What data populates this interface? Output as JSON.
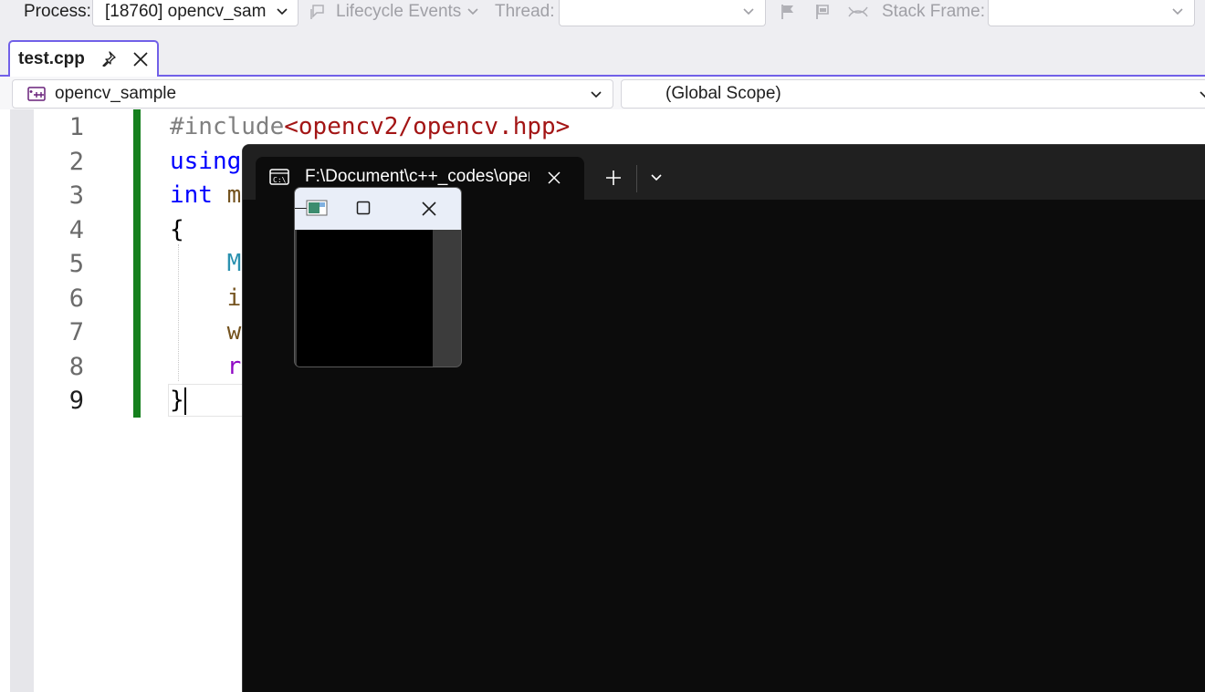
{
  "toolbar": {
    "process_label": "Process:",
    "process_value": "[18760] opencv_sam",
    "lifecycle_label": "Lifecycle Events",
    "thread_label": "Thread:",
    "thread_value": "",
    "stack_frame_label": "Stack Frame:",
    "stack_frame_value": ""
  },
  "tabs": [
    {
      "label": "test.cpp",
      "active": true
    }
  ],
  "navigation": {
    "project": "opencv_sample",
    "scope": "(Global Scope)"
  },
  "editor": {
    "current_line": 9,
    "lines": [
      {
        "num": "1",
        "tokens": [
          {
            "text": "#include",
            "role": "preprocessor"
          },
          {
            "text": "<opencv2/opencv.hpp>",
            "role": "string"
          }
        ]
      },
      {
        "num": "2",
        "tokens": [
          {
            "text": "using",
            "role": "keyword"
          }
        ]
      },
      {
        "num": "3",
        "tokens": [
          {
            "text": "int",
            "role": "keyword"
          },
          {
            "text": " m",
            "role": "function"
          }
        ]
      },
      {
        "num": "4",
        "tokens": [
          {
            "text": "{",
            "role": "plain"
          }
        ]
      },
      {
        "num": "5",
        "tokens": [
          {
            "text": "    M",
            "role": "type"
          }
        ]
      },
      {
        "num": "6",
        "tokens": [
          {
            "text": "    i",
            "role": "function"
          }
        ]
      },
      {
        "num": "7",
        "tokens": [
          {
            "text": "    w",
            "role": "function"
          }
        ]
      },
      {
        "num": "8",
        "tokens": [
          {
            "text": "    r",
            "role": "control"
          }
        ]
      },
      {
        "num": "9",
        "tokens": [
          {
            "text": "}",
            "role": "plain"
          }
        ]
      }
    ]
  },
  "syntax_colors": {
    "preprocessor": "#808080",
    "string": "#a31515",
    "keyword": "#0000ff",
    "function": "#74531f",
    "type": "#2b91af",
    "control": "#8f08c4",
    "plain": "#000000"
  },
  "terminal": {
    "tab_title": "F:\\Document\\c++_codes\\opencv_sample"
  },
  "colors": {
    "accent": "#7160e8",
    "change_bar": "#15801d",
    "terminal_bg": "#0c0c0c"
  }
}
